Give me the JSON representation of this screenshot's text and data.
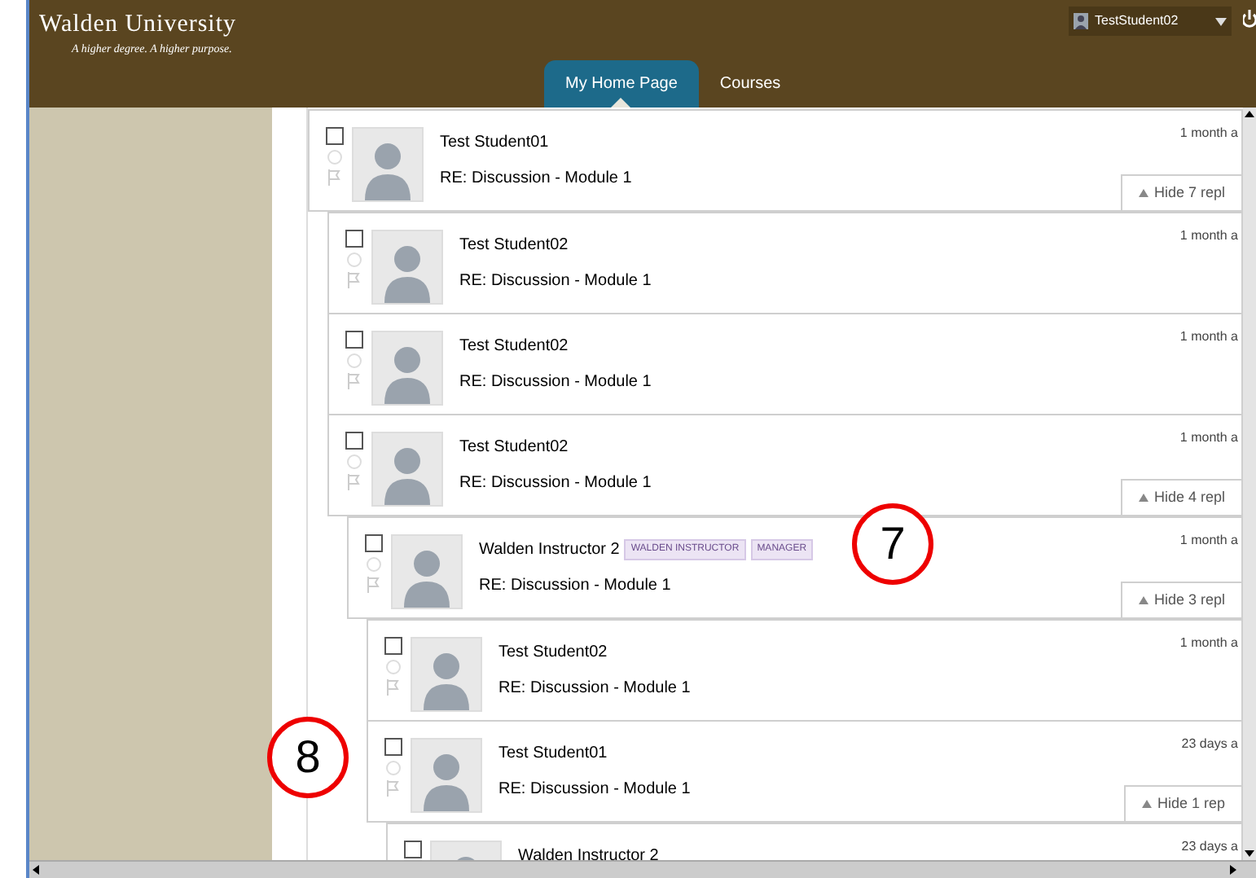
{
  "header": {
    "logo": "Walden University",
    "tagline": "A higher degree. A higher purpose.",
    "user": "TestStudent02",
    "tabs": [
      {
        "label": "My Home Page",
        "selected": true
      },
      {
        "label": "Courses",
        "selected": false
      }
    ]
  },
  "posts": [
    {
      "author": "Test Student01",
      "subject": "RE: Discussion - Module 1",
      "time": "1 month a",
      "checked": false,
      "hide": "Hide 7 repl",
      "children": [
        {
          "author": "Test Student02",
          "subject": "RE: Discussion - Module 1",
          "time": "1 month a",
          "checked": false
        },
        {
          "author": "Test Student02",
          "subject": "RE: Discussion - Module 1",
          "time": "1 month a",
          "checked": false
        },
        {
          "author": "Test Student02",
          "subject": "RE: Discussion - Module 1",
          "time": "1 month a",
          "checked": false,
          "hide": "Hide 4 repl",
          "children": [
            {
              "author": "Walden Instructor 2",
              "tags": [
                "WALDEN INSTRUCTOR",
                "MANAGER"
              ],
              "subject": "RE: Discussion - Module 1",
              "time": "1 month a",
              "checked": false,
              "hide": "Hide 3 repl",
              "children": [
                {
                  "author": "Test Student02",
                  "subject": "RE: Discussion - Module 1",
                  "time": "1 month a",
                  "checked": false
                },
                {
                  "author": "Test Student01",
                  "subject": "RE: Discussion - Module 1",
                  "time": "23 days a",
                  "checked": false,
                  "hide": "Hide 1 rep",
                  "children": [
                    {
                      "author": "Walden Instructor 2",
                      "time": "23 days a",
                      "checked": false
                    }
                  ]
                }
              ]
            }
          ]
        }
      ]
    }
  ],
  "callouts": [
    "7",
    "8"
  ]
}
